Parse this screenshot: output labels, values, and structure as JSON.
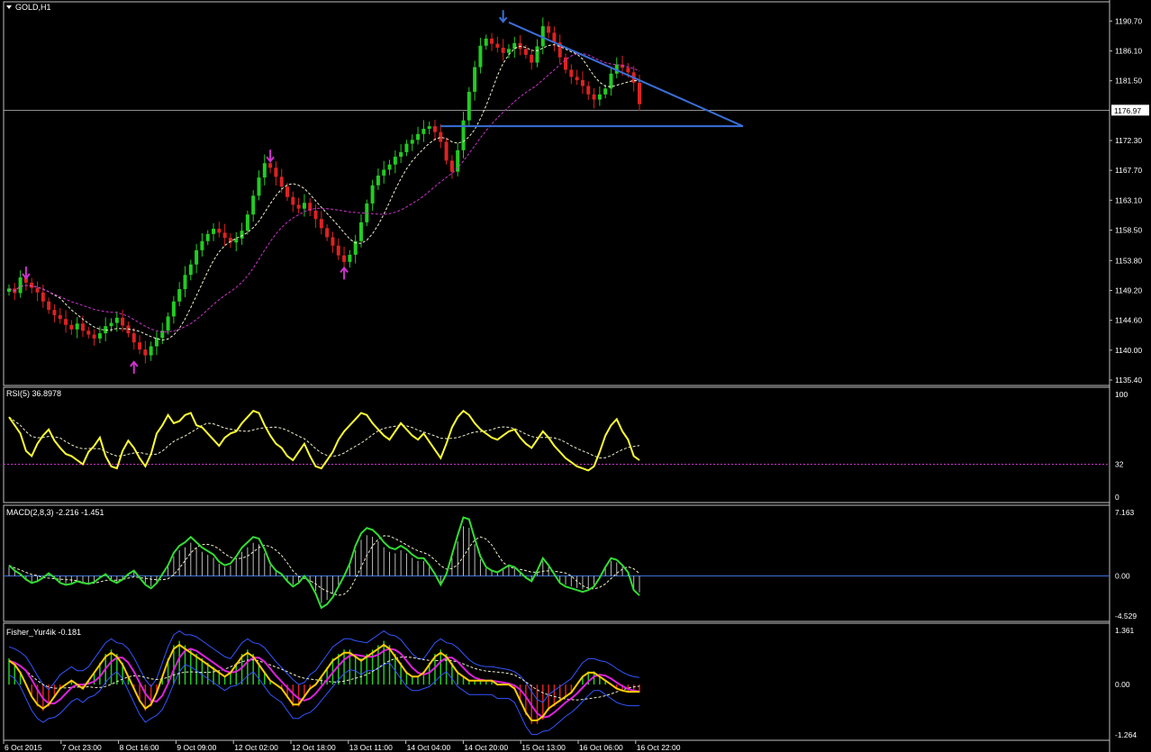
{
  "window": {
    "title": "GOLD,H1",
    "current_price_label": "1176.97"
  },
  "colors": {
    "background": "#000000",
    "grid_line": "#c0c0c0",
    "bull_candle": "#22cc22",
    "bear_candle": "#dd2222",
    "fast_ma": "#f0f0d0",
    "slow_ma": "#cc33cc",
    "trendline": "#3a6fd8",
    "arrow": "#cc33cc",
    "rsi": "#ffff33",
    "macd": "#33dd33",
    "fisher_fast": "#ffcc00",
    "fisher_slow": "#dd22dd",
    "fisher_band": "#3355ff"
  },
  "chart_data": [
    {
      "type": "candlestick",
      "title": "GOLD,H1",
      "y_ticks": [
        "1190.70",
        "1186.10",
        "1181.50",
        "1176.97",
        "1172.30",
        "1167.70",
        "1163.10",
        "1158.50",
        "1153.80",
        "1149.20",
        "1144.60",
        "1140.00",
        "1135.40"
      ],
      "ylim": [
        1135.4,
        1192.0
      ],
      "x_ticks": [
        "6 Oct 2015",
        "7 Oct 23:00",
        "8 Oct 16:00",
        "9 Oct 09:00",
        "12 Oct 02:00",
        "12 Oct 18:00",
        "13 Oct 11:00",
        "14 Oct 04:00",
        "14 Oct 20:00",
        "15 Oct 13:00",
        "16 Oct 06:00",
        "16 Oct 22:00"
      ],
      "current_price": 1176.97,
      "close_path": [
        1149.5,
        1148.8,
        1151.2,
        1150.4,
        1149.6,
        1148.9,
        1147.5,
        1146.2,
        1145.4,
        1144.8,
        1143.9,
        1143.2,
        1144.1,
        1143.0,
        1142.4,
        1141.8,
        1142.6,
        1143.7,
        1144.2,
        1145.0,
        1143.8,
        1142.6,
        1141.2,
        1140.1,
        1139.2,
        1140.6,
        1141.9,
        1143.0,
        1145.2,
        1147.5,
        1149.4,
        1151.6,
        1153.2,
        1155.4,
        1156.8,
        1157.9,
        1158.7,
        1158.1,
        1157.3,
        1156.6,
        1157.2,
        1158.4,
        1160.9,
        1163.8,
        1166.6,
        1168.8,
        1168.1,
        1166.7,
        1165.2,
        1163.6,
        1162.4,
        1161.8,
        1162.7,
        1161.5,
        1160.2,
        1158.8,
        1157.4,
        1156.1,
        1154.6,
        1153.6,
        1154.7,
        1156.8,
        1159.7,
        1162.6,
        1165.4,
        1166.9,
        1167.8,
        1168.6,
        1169.8,
        1170.5,
        1171.8,
        1172.4,
        1173.3,
        1174.1,
        1174.5,
        1173.6,
        1172.1,
        1169.2,
        1167.5,
        1170.8,
        1175.4,
        1179.8,
        1183.6,
        1186.9,
        1188.0,
        1187.2,
        1186.6,
        1185.8,
        1186.4,
        1187.3,
        1186.4,
        1185.5,
        1184.3,
        1186.8,
        1189.9,
        1188.9,
        1187.4,
        1185.1,
        1183.2,
        1182.1,
        1181.6,
        1180.7,
        1179.4,
        1178.6,
        1179.4,
        1180.3,
        1182.6,
        1184.0,
        1183.5,
        1182.8,
        1181.2,
        1177.9
      ],
      "series": [
        {
          "name": "fast_ma",
          "values": []
        },
        {
          "name": "slow_ma",
          "values": []
        }
      ],
      "annotations": [
        {
          "type": "arrow-down",
          "x_index": 3,
          "price": 1151.5
        },
        {
          "type": "arrow-up",
          "x_index": 22,
          "price": 1137.5
        },
        {
          "type": "arrow-down",
          "x_index": 46,
          "price": 1169.5
        },
        {
          "type": "arrow-up",
          "x_index": 59,
          "price": 1152.0
        },
        {
          "type": "arrow-down",
          "x_index": 87,
          "price": 1191.0
        },
        {
          "type": "trendline",
          "from": [
            88,
            1190.5
          ],
          "to": [
            121,
            1174.5
          ]
        },
        {
          "type": "trendline",
          "from": [
            76,
            1174.5
          ],
          "to": [
            121,
            1174.5
          ]
        }
      ]
    },
    {
      "type": "line",
      "title": "RSI(5) 36.8978",
      "y_ticks": [
        "100",
        "32",
        "0"
      ],
      "ylim": [
        0,
        100
      ],
      "level": 32,
      "values": [
        78,
        70,
        62,
        45,
        40,
        52,
        60,
        66,
        55,
        48,
        42,
        40,
        36,
        32,
        44,
        50,
        58,
        40,
        30,
        28,
        45,
        55,
        48,
        38,
        30,
        42,
        62,
        70,
        80,
        72,
        74,
        80,
        82,
        70,
        68,
        62,
        56,
        50,
        58,
        62,
        64,
        72,
        78,
        84,
        82,
        70,
        60,
        52,
        48,
        40,
        36,
        44,
        52,
        40,
        30,
        28,
        36,
        44,
        56,
        64,
        70,
        76,
        82,
        80,
        72,
        66,
        60,
        56,
        64,
        72,
        66,
        60,
        56,
        62,
        54,
        46,
        38,
        52,
        68,
        78,
        84,
        80,
        72,
        66,
        62,
        58,
        56,
        60,
        64,
        66,
        58,
        52,
        48,
        56,
        64,
        58,
        50,
        44,
        38,
        34,
        30,
        28,
        26,
        30,
        44,
        60,
        70,
        76,
        64,
        56,
        40,
        36
      ],
      "signal": []
    },
    {
      "type": "line",
      "title": "MACD(2,8,3) -2.216 -1.451",
      "y_ticks": [
        "7.163",
        "0.00",
        "-4.529"
      ],
      "ylim": [
        -4.529,
        7.163
      ],
      "values": [
        1.2,
        0.6,
        0.2,
        -0.4,
        -0.8,
        -0.6,
        -0.2,
        0.3,
        -0.2,
        -0.8,
        -1.0,
        -0.9,
        -0.6,
        -0.8,
        -0.9,
        -0.7,
        -0.2,
        0.2,
        -0.5,
        -0.8,
        -0.4,
        0.2,
        0.6,
        -0.2,
        -1.0,
        -1.4,
        -0.8,
        0.2,
        1.2,
        2.6,
        3.4,
        3.8,
        4.4,
        3.8,
        3.2,
        2.8,
        2.4,
        1.6,
        1.2,
        1.4,
        2.2,
        3.2,
        3.8,
        4.4,
        4.2,
        3.0,
        1.4,
        0.6,
        0.2,
        -0.6,
        -1.2,
        -0.8,
        0.0,
        -0.8,
        -2.0,
        -3.6,
        -3.2,
        -2.4,
        -1.2,
        0.0,
        1.4,
        3.4,
        4.8,
        5.4,
        5.2,
        4.6,
        3.8,
        3.2,
        3.0,
        3.4,
        3.0,
        2.4,
        2.0,
        2.0,
        1.2,
        0.2,
        -1.0,
        0.2,
        2.4,
        4.6,
        6.6,
        6.4,
        4.2,
        2.2,
        1.0,
        0.6,
        0.4,
        0.8,
        1.2,
        1.0,
        0.4,
        -0.2,
        -0.6,
        0.6,
        2.0,
        1.2,
        0.2,
        -0.8,
        -1.2,
        -1.4,
        -1.6,
        -1.8,
        -1.6,
        -1.2,
        -0.2,
        1.0,
        2.0,
        1.8,
        1.2,
        0.4,
        -1.6,
        -2.2
      ],
      "signal": []
    },
    {
      "type": "line",
      "title": "Fisher_Yur4ik -0.181",
      "y_ticks": [
        "1.361",
        "0.00",
        "-1.264"
      ],
      "ylim": [
        -1.264,
        1.361
      ],
      "values": [
        0.6,
        0.5,
        0.3,
        0.0,
        -0.3,
        -0.5,
        -0.6,
        -0.5,
        -0.3,
        -0.1,
        0.0,
        0.1,
        0.0,
        -0.1,
        0.1,
        0.3,
        0.5,
        0.7,
        0.8,
        0.7,
        0.5,
        0.2,
        -0.1,
        -0.4,
        -0.6,
        -0.5,
        -0.2,
        0.2,
        0.6,
        0.9,
        1.0,
        0.9,
        0.8,
        0.7,
        0.6,
        0.5,
        0.4,
        0.3,
        0.2,
        0.3,
        0.5,
        0.7,
        0.8,
        0.7,
        0.5,
        0.3,
        0.1,
        0.0,
        -0.1,
        -0.3,
        -0.5,
        -0.5,
        -0.3,
        -0.1,
        0.0,
        0.2,
        0.4,
        0.6,
        0.7,
        0.8,
        0.8,
        0.7,
        0.6,
        0.7,
        0.8,
        0.9,
        1.0,
        0.9,
        0.7,
        0.5,
        0.3,
        0.2,
        0.2,
        0.3,
        0.5,
        0.7,
        0.8,
        0.7,
        0.5,
        0.3,
        0.2,
        0.1,
        0.1,
        0.1,
        0.1,
        0.1,
        0.0,
        0.0,
        0.0,
        -0.1,
        -0.4,
        -0.7,
        -0.9,
        -0.9,
        -0.8,
        -0.6,
        -0.5,
        -0.4,
        -0.3,
        -0.2,
        0.0,
        0.2,
        0.3,
        0.3,
        0.2,
        0.1,
        0.0,
        -0.1,
        -0.15,
        -0.18,
        -0.18,
        -0.181
      ],
      "signal": []
    }
  ]
}
